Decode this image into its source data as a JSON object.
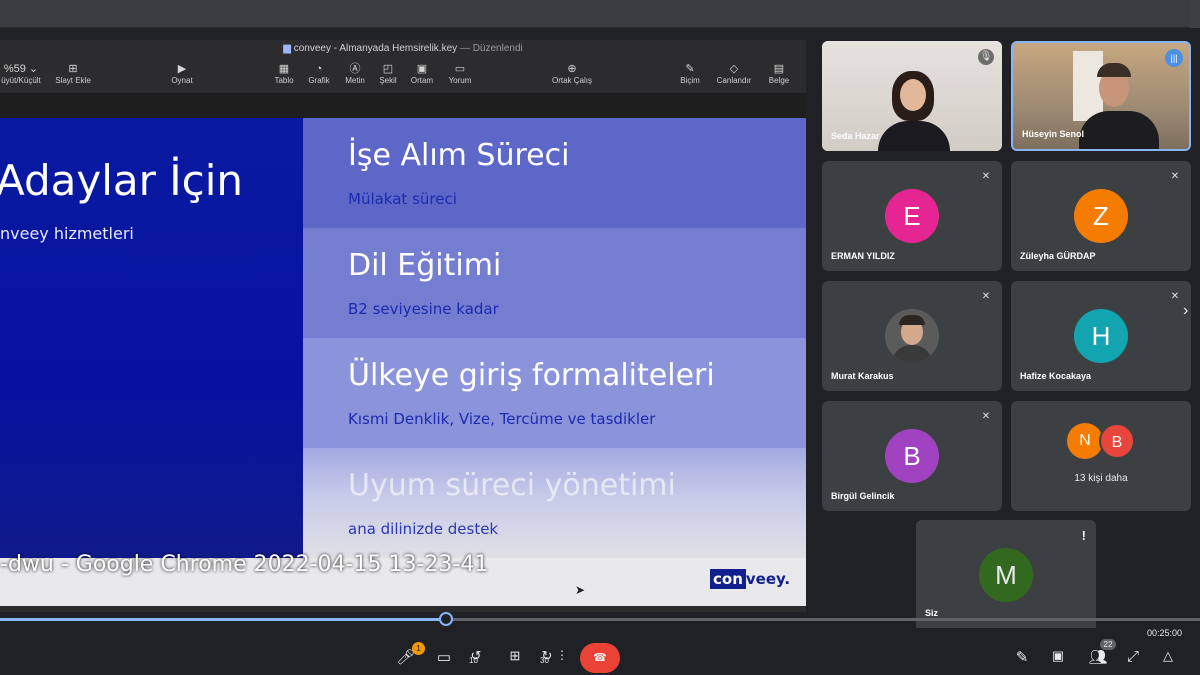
{
  "keynote": {
    "doc_title": "conveey - Almanyada Hemsirelik.key",
    "doc_separator": "—",
    "doc_status": "Düzenlendi",
    "zoom": "%59 ⌄",
    "toolbar": [
      {
        "label": "Büyüt/Küçült",
        "icon": "zoom"
      },
      {
        "label": "Slayt Ekle",
        "icon": "add-slide"
      },
      {
        "label": "Oynat",
        "icon": "play"
      },
      {
        "label": "Tablo",
        "icon": "table"
      },
      {
        "label": "Grafik",
        "icon": "chart"
      },
      {
        "label": "Metin",
        "icon": "text"
      },
      {
        "label": "Şekil",
        "icon": "shape"
      },
      {
        "label": "Ortam",
        "icon": "media"
      },
      {
        "label": "Yorum",
        "icon": "comment"
      },
      {
        "label": "Ortak Çalış",
        "icon": "collaborate"
      },
      {
        "label": "Biçim",
        "icon": "format"
      },
      {
        "label": "Canlandır",
        "icon": "animate"
      },
      {
        "label": "Belge",
        "icon": "document"
      }
    ],
    "toolbar_first_label": "üyüt/Küçült"
  },
  "slide": {
    "left_title": "Adaylar İçin",
    "left_subtitle": "nveey hizmetleri",
    "rows": [
      {
        "heading": "İşe Alım Süreci",
        "sub": "Mülakat süreci"
      },
      {
        "heading": "Dil Eğitimi",
        "sub": "B2 seviyesine kadar"
      },
      {
        "heading": "Ülkeye giriş formaliteleri",
        "sub": "Kısmi Denklik, Vize, Tercüme ve tasdikler"
      },
      {
        "heading": "Uyum süreci yönetimi",
        "sub": "ana dilinizde destek"
      }
    ],
    "logo_con": "con",
    "logo_rest": "veey.",
    "caption": "-dwu - Google Chrome 2022-04-15 13-23-41"
  },
  "participants": [
    {
      "name": "Seda Hazar",
      "type": "video",
      "muted": true
    },
    {
      "name": "Hüseyin Senol",
      "type": "video",
      "speaking": true
    },
    {
      "name": "ERMAN YILDIZ",
      "initial": "E",
      "color": "#e52592",
      "muted": true
    },
    {
      "name": "Züleyha GÜRDAP",
      "initial": "Z",
      "color": "#f57c00",
      "muted": true
    },
    {
      "name": "Murat Karakus",
      "type": "photo",
      "muted": true
    },
    {
      "name": "Hafize Kocakaya",
      "initial": "H",
      "color": "#12a4af",
      "muted": true
    },
    {
      "name": "Birgül Gelincik",
      "initial": "B",
      "color": "#a142c1",
      "muted": true
    },
    {
      "more_label": "13 kişi daha",
      "initials": [
        "N",
        "B"
      ],
      "colors": [
        "#f57c00",
        "#e8453c"
      ]
    }
  ],
  "self_tile": {
    "name": "Siz",
    "initial": "M",
    "color": "#33691e",
    "alert": "!"
  },
  "player": {
    "time": "00:25:00",
    "progress_pct": 37,
    "skip_back": "10",
    "skip_fwd": "30",
    "people_count": "22",
    "notif_count": "1"
  }
}
